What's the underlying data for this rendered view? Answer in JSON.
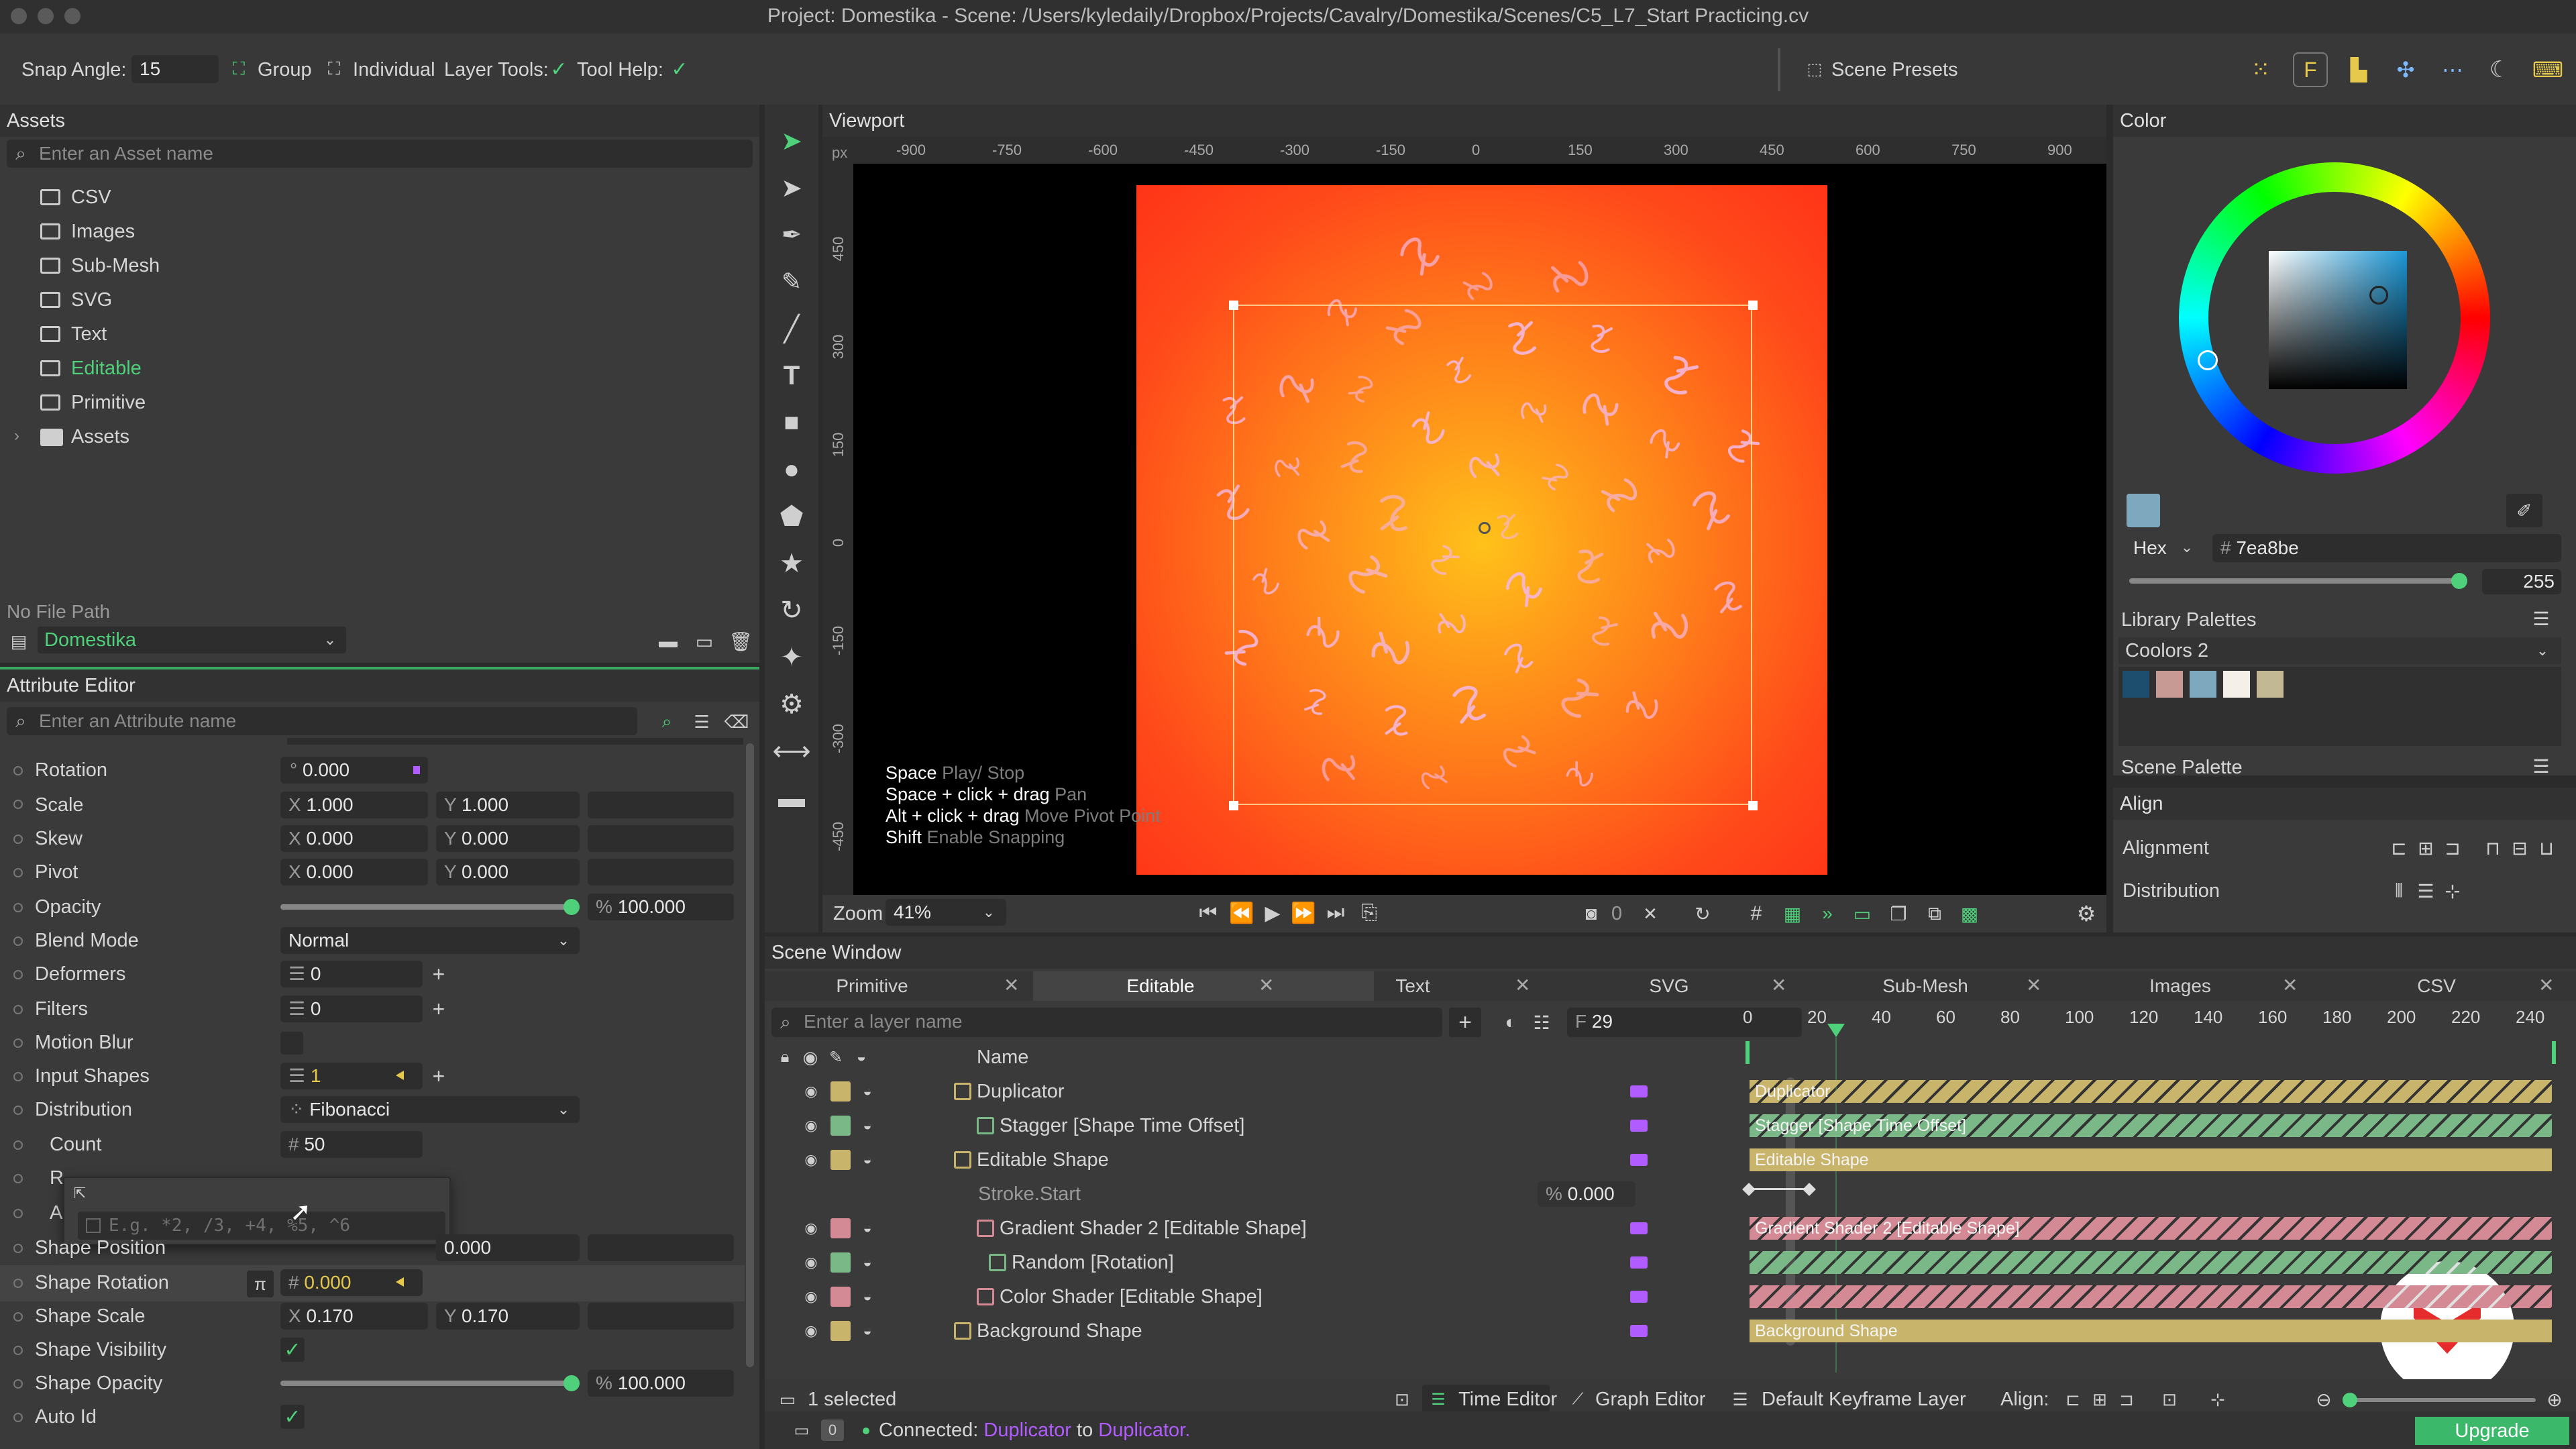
{
  "window": {
    "title": "Project: Domestika - Scene: /Users/kyledaily/Dropbox/Projects/Cavalry/Domestika/Scenes/C5_L7_Start Practicing.cv"
  },
  "toolbar": {
    "snap_angle_label": "Snap Angle:",
    "snap_angle_value": "15",
    "group_label": "Group",
    "individual_label": "Individual",
    "layer_tools_label": "Layer Tools:",
    "tool_help_label": "Tool Help:",
    "scene_presets_label": "Scene Presets"
  },
  "assets": {
    "title": "Assets",
    "search_placeholder": "Enter an Asset name",
    "items": [
      {
        "label": "CSV"
      },
      {
        "label": "Images"
      },
      {
        "label": "Sub-Mesh"
      },
      {
        "label": "SVG"
      },
      {
        "label": "Text"
      },
      {
        "label": "Editable"
      },
      {
        "label": "Primitive"
      },
      {
        "label": "Assets"
      }
    ],
    "file_path": "No File Path",
    "project": "Domestika"
  },
  "attribute_editor": {
    "title": "Attribute Editor",
    "search_placeholder": "Enter an Attribute name",
    "rows": [
      {
        "label": "Rotation",
        "a": "0.000"
      },
      {
        "label": "Scale",
        "ax": "X",
        "a": "1.000",
        "bx": "Y",
        "b": "1.000"
      },
      {
        "label": "Skew",
        "ax": "X",
        "a": "0.000",
        "bx": "Y",
        "b": "0.000"
      },
      {
        "label": "Pivot",
        "ax": "X",
        "a": "0.000",
        "bx": "Y",
        "b": "0.000"
      },
      {
        "label": "Opacity",
        "a": "100.000",
        "unit": "%"
      },
      {
        "label": "Blend Mode",
        "a": "Normal"
      },
      {
        "label": "Deformers",
        "a": "0"
      },
      {
        "label": "Filters",
        "a": "0"
      },
      {
        "label": "Motion Blur"
      },
      {
        "label": "Input Shapes",
        "a": "1"
      },
      {
        "label": "Distribution",
        "a": "Fibonacci"
      },
      {
        "label": "Count",
        "a": "50"
      },
      {
        "label": "Shape Position",
        "b": "0.000"
      },
      {
        "label": "Shape Rotation",
        "a": "0.000"
      },
      {
        "label": "Shape Scale",
        "ax": "X",
        "a": "0.170",
        "bx": "Y",
        "b": "0.170"
      },
      {
        "label": "Shape Visibility"
      },
      {
        "label": "Shape Opacity",
        "a": "100.000",
        "unit": "%"
      },
      {
        "label": "Auto Id"
      }
    ],
    "expression_placeholder": "E.g. *2, /3, +4, %5, ^6",
    "truncated_r": "R",
    "truncated_a": "A"
  },
  "viewport": {
    "title": "Viewport",
    "unit": "px",
    "ruler_x": [
      "-900",
      "-750",
      "-600",
      "-450",
      "-300",
      "-150",
      "0",
      "150",
      "300",
      "450",
      "600",
      "750",
      "900"
    ],
    "ruler_y": [
      "450",
      "300",
      "150",
      "0",
      "-150",
      "-300",
      "-450"
    ],
    "help": [
      {
        "key": "Space",
        "desc": "Play/ Stop"
      },
      {
        "key": "Space + click + drag",
        "desc": "Pan"
      },
      {
        "key": "Alt + click + drag",
        "desc": "Move Pivot Point"
      },
      {
        "key": "Shift",
        "desc": "Enable Snapping"
      }
    ],
    "zoom_label": "Zoom",
    "zoom_value": "41%",
    "counter": "0"
  },
  "color_panel": {
    "title": "Color",
    "mode": "Hex",
    "hex": "7ea8be",
    "alpha": "255",
    "library_title": "Library Palettes",
    "palette_name": "Coolors 2",
    "palette_colors": [
      "#1e4e6e",
      "#c79a94",
      "#7ea8be",
      "#f4efe8",
      "#c2b894"
    ],
    "scene_palette_title": "Scene Palette"
  },
  "align_panel": {
    "title": "Align",
    "alignment_label": "Alignment",
    "distribution_label": "Distribution"
  },
  "scene_window": {
    "title": "Scene Window",
    "tabs": [
      {
        "label": "Primitive"
      },
      {
        "label": "Editable"
      },
      {
        "label": "Text"
      },
      {
        "label": "SVG"
      },
      {
        "label": "Sub-Mesh"
      },
      {
        "label": "Images"
      },
      {
        "label": "CSV"
      }
    ],
    "search_placeholder": "Enter a layer name",
    "frame": "29",
    "name_header": "Name",
    "layers": [
      {
        "name": "Duplicator",
        "color": "#c8b46a"
      },
      {
        "name": "Stagger [Shape Time Offset]",
        "color": "#7ab888"
      },
      {
        "name": "Editable Shape",
        "color": "#c8b46a"
      },
      {
        "name": "Stroke.Start",
        "value": "0.000",
        "unit": "%"
      },
      {
        "name": "Gradient Shader 2 [Editable Shape]",
        "color": "#d48a94"
      },
      {
        "name": "Random [Rotation]",
        "color": "#7ab888"
      },
      {
        "name": "Color Shader [Editable Shape]",
        "color": "#d48a94"
      },
      {
        "name": "Background Shape",
        "color": "#c8b46a"
      }
    ],
    "timeline_ticks": [
      "0",
      "20",
      "40",
      "60",
      "80",
      "100",
      "120",
      "140",
      "160",
      "180",
      "200",
      "220",
      "240"
    ],
    "bars": [
      "Duplicator",
      "Stagger [Shape Time Offset]",
      "Editable Shape",
      "Gradient Shader 2 [Editable Shape]",
      "",
      "",
      "Background Shape"
    ],
    "selected": "1 selected",
    "time_editor": "Time Editor",
    "graph_editor": "Graph Editor",
    "keyframe_layer": "Default Keyframe Layer",
    "align_label": "Align:"
  },
  "status": {
    "count": "0",
    "prefix": "Connected:",
    "from": "Duplicator",
    "mid": "to",
    "to": "Duplicator.",
    "upgrade": "Upgrade"
  },
  "accent": {
    "green": "#4fd07a",
    "purple": "#b05cff",
    "orange_start": "#ff3d1a",
    "orange_center": "#ffb020"
  }
}
